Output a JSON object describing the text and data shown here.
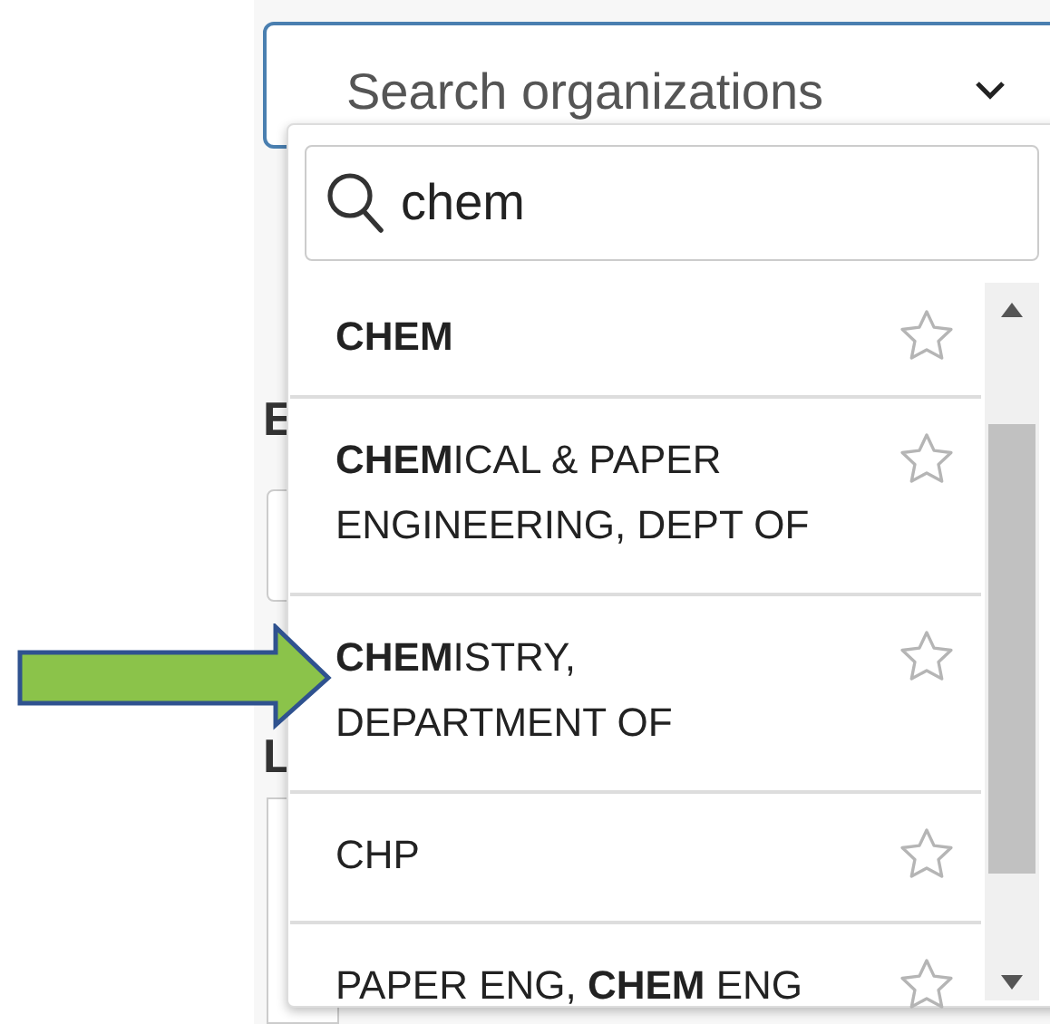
{
  "select": {
    "placeholder": "Search organizations"
  },
  "background": {
    "heading_1": "E",
    "heading_2": "L"
  },
  "search": {
    "value": "chem"
  },
  "options": [
    {
      "label": "CHEM",
      "bold": true
    },
    {
      "label": "**CHEM**ICAL & PAPER ENGINEERING, DEPT OF",
      "bold": false
    },
    {
      "label": "**CHEM**ISTRY, DEPARTMENT OF",
      "bold": false
    },
    {
      "label": "CHP",
      "bold": false
    },
    {
      "label": "PAPER ENG, **CHEM** ENG",
      "bold": false
    }
  ]
}
